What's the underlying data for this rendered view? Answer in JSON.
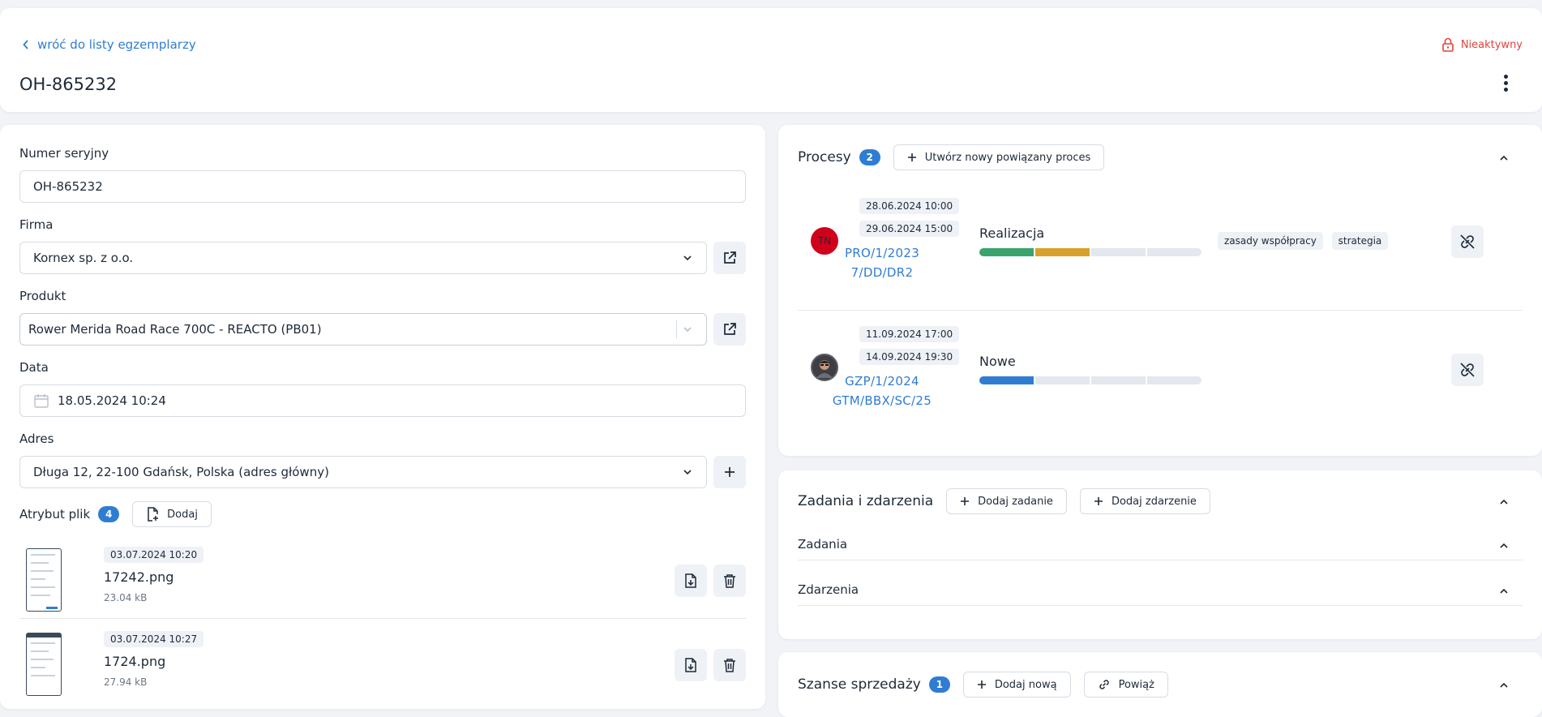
{
  "header": {
    "back_label": "wróć do listy egzemplarzy",
    "title": "OH-865232",
    "status": "Nieaktywny"
  },
  "form": {
    "serial": {
      "label": "Numer seryjny",
      "value": "OH-865232"
    },
    "company": {
      "label": "Firma",
      "value": "Kornex sp. z o.o."
    },
    "product": {
      "label": "Produkt",
      "value": "Rower Merida Road Race 700C - REACTO (PB01)"
    },
    "date": {
      "label": "Data",
      "value": "18.05.2024 10:24"
    },
    "address": {
      "label": "Adres",
      "value": "Długa 12, 22-100 Gdańsk, Polska (adres główny)"
    },
    "attachments": {
      "label": "Atrybut plik",
      "count": "4",
      "add_label": "Dodaj",
      "files": [
        {
          "date": "03.07.2024 10:20",
          "name": "17242.png",
          "size": "23.04 kB"
        },
        {
          "date": "03.07.2024 10:27",
          "name": "1724.png",
          "size": "27.94 kB"
        }
      ]
    }
  },
  "processes": {
    "title": "Procesy",
    "count": "2",
    "create_label": "Utwórz nowy powiązany proces",
    "items": [
      {
        "avatar_initials": "TN",
        "avatar_color": "#d0021b",
        "start": "28.06.2024 10:00",
        "end": "29.06.2024 15:00",
        "id_line1": "PRO/1/2023",
        "id_line2": "7/DD/DR2",
        "stage": "Realizacja",
        "progress_colors": [
          "#3aa36b",
          "#d9a12b",
          "#e3e8ee",
          "#e3e8ee"
        ],
        "tags": [
          "zasady współpracy",
          "strategia"
        ]
      },
      {
        "avatar_initials": "",
        "avatar_color": "#3d3f44",
        "start": "11.09.2024 17:00",
        "end": "14.09.2024 19:30",
        "id_line1": "GZP/1/2024",
        "id_line2": "GTM/BBX/SC/25",
        "stage": "Nowe",
        "progress_colors": [
          "#2f7dd2",
          "#e3e8ee",
          "#e3e8ee",
          "#e3e8ee"
        ],
        "tags": []
      }
    ]
  },
  "tasks": {
    "title": "Zadania i zdarzenia",
    "add_task_label": "Dodaj zadanie",
    "add_event_label": "Dodaj zdarzenie",
    "tasks_label": "Zadania",
    "events_label": "Zdarzenia"
  },
  "sales": {
    "title": "Szanse sprzedaży",
    "count": "1",
    "add_label": "Dodaj nową",
    "link_label": "Powiąż"
  }
}
